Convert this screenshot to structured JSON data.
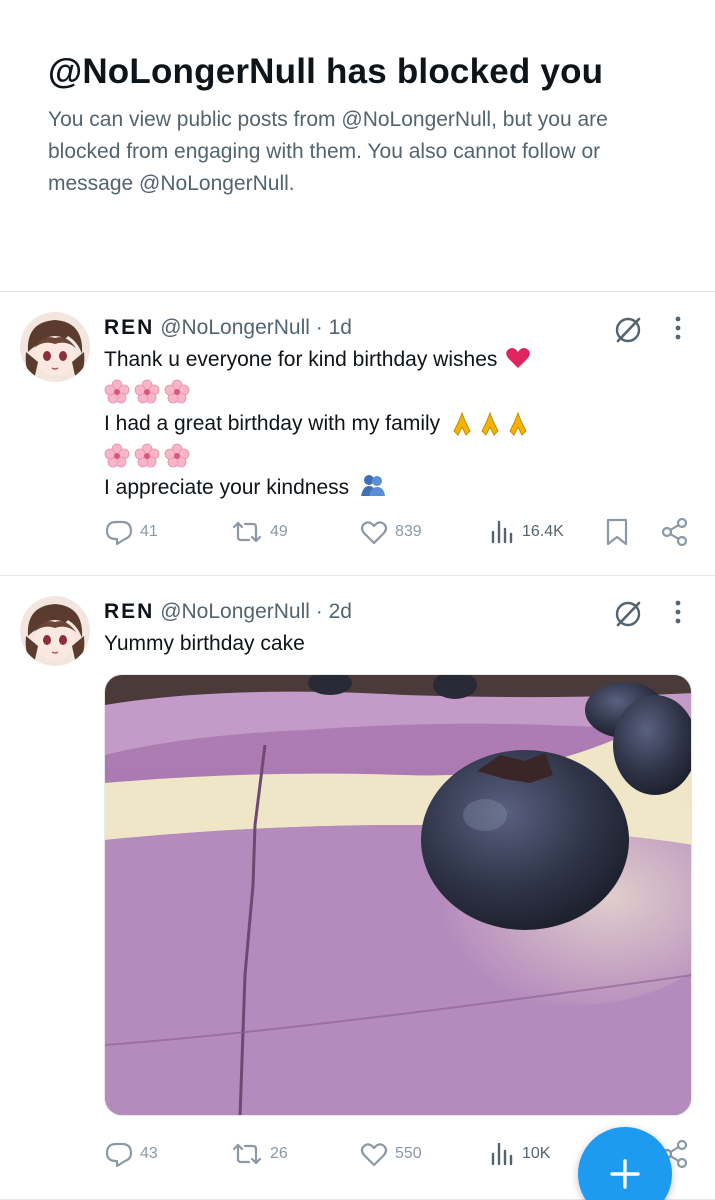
{
  "blocked": {
    "title": "@NoLongerNull has blocked you",
    "description": "You can view public posts from @NoLongerNull, but you are blocked from engaging with them. You also cannot follow or message @NoLongerNull."
  },
  "posts": [
    {
      "name": "REN",
      "handle": "@NoLongerNull",
      "dot": "·",
      "time": "1d",
      "lines": [
        "Thank u everyone for kind birthday wishes",
        "I had a great birthday with my family",
        "I appreciate your kindness"
      ],
      "stats": {
        "replies": "41",
        "reposts": "49",
        "likes": "839",
        "views": "16.4K"
      }
    },
    {
      "name": "REN",
      "handle": "@NoLongerNull",
      "dot": "·",
      "time": "2d",
      "lines": [
        "Yummy birthday cake"
      ],
      "stats": {
        "replies": "43",
        "reposts": "26",
        "likes": "550",
        "views": "10K"
      }
    }
  ],
  "colors": {
    "accent": "#1d9bf0",
    "secondary_text": "#536471",
    "icon_gray": "#8b98a5",
    "heart_red": "#e0245e"
  },
  "icons": [
    "grok-icon",
    "more-icon",
    "reply-icon",
    "repost-icon",
    "like-icon",
    "views-icon",
    "bookmark-icon",
    "share-icon",
    "compose-plus-icon"
  ]
}
